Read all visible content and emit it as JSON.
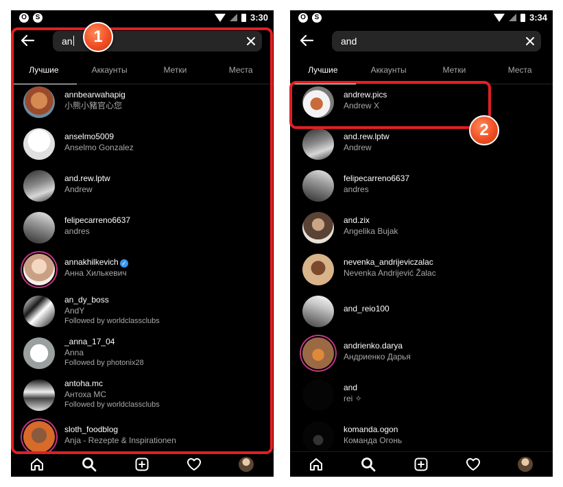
{
  "left": {
    "status_time": "3:30",
    "search_value": "an",
    "tabs": [
      "Лучшие",
      "Аккаунты",
      "Метки",
      "Места"
    ],
    "results": [
      {
        "username": "annbearwahapig",
        "fullname": "小熊小豬官心您",
        "extra": ""
      },
      {
        "username": "anselmo5009",
        "fullname": "Anselmo Gonzalez",
        "extra": ""
      },
      {
        "username": "and.rew.lptw",
        "fullname": "Andrew",
        "extra": ""
      },
      {
        "username": "felipecarreno6637",
        "fullname": "andres",
        "extra": ""
      },
      {
        "username": "annakhilkevich",
        "fullname": "Анна Хилькевич",
        "extra": ""
      },
      {
        "username": "an_dy_boss",
        "fullname": "AndY",
        "extra": "Followed by worldclassclubs"
      },
      {
        "username": "_anna_17_04",
        "fullname": "Anna",
        "extra": "Followed by photonix28"
      },
      {
        "username": "antoha.mc",
        "fullname": "Антоха МС",
        "extra": "Followed by worldclassclubs"
      },
      {
        "username": "sloth_foodblog",
        "fullname": "Anja - Rezepte & Inspirationen",
        "extra": ""
      }
    ],
    "marker": "1"
  },
  "right": {
    "status_time": "3:34",
    "search_value": "and",
    "tabs": [
      "Лучшие",
      "Аккаунты",
      "Метки",
      "Места"
    ],
    "results": [
      {
        "username": "andrew.pics",
        "fullname": "Andrew X",
        "extra": ""
      },
      {
        "username": "and.rew.lptw",
        "fullname": "Andrew",
        "extra": ""
      },
      {
        "username": "felipecarreno6637",
        "fullname": "andres",
        "extra": ""
      },
      {
        "username": "and.zix",
        "fullname": "Angelika Bujak",
        "extra": ""
      },
      {
        "username": "nevenka_andrijeviczalac",
        "fullname": "Nevenka Andrijević Žalac",
        "extra": ""
      },
      {
        "username": "and_reio100",
        "fullname": "",
        "extra": ""
      },
      {
        "username": "andrienko.darya",
        "fullname": "Андриенко Дарья",
        "extra": ""
      },
      {
        "username": "and",
        "fullname": "rei ✧",
        "extra": ""
      },
      {
        "username": "komanda.ogon",
        "fullname": "Команда Огонь",
        "extra": ""
      }
    ],
    "marker": "2"
  },
  "colors": {
    "background": "#000000",
    "field": "#262626",
    "secondary_text": "#a8a8a8",
    "highlight": "#e31e24",
    "verified": "#3897f0"
  },
  "icons": {
    "back": "arrow-left-icon",
    "clear": "close-icon",
    "nav": [
      "home-icon",
      "search-icon",
      "add-post-icon",
      "heart-icon",
      "profile-avatar"
    ]
  }
}
